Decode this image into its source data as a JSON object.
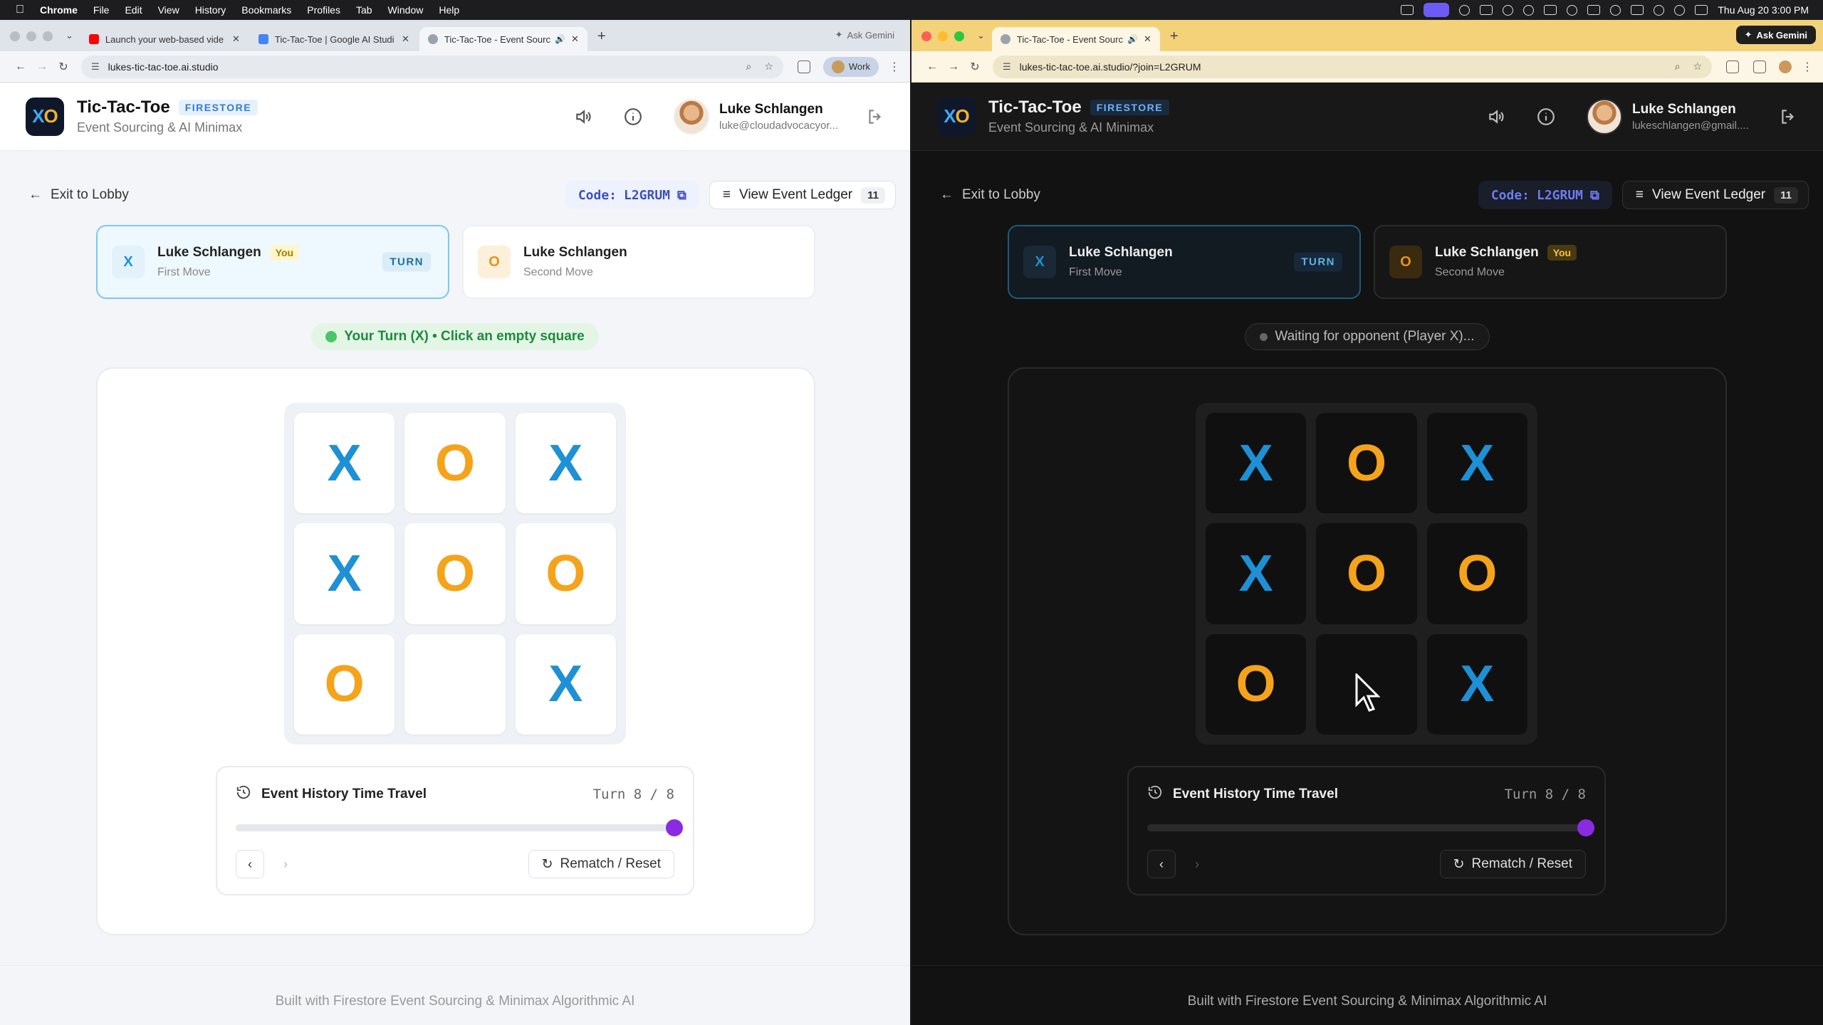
{
  "menubar": {
    "app": "Chrome",
    "items": [
      "File",
      "Edit",
      "View",
      "History",
      "Bookmarks",
      "Profiles",
      "Tab",
      "Window",
      "Help"
    ],
    "clock": "Thu Aug 20  3:00 PM"
  },
  "colors": {
    "x": "#1e90d6",
    "o": "#f5a31a",
    "accent": "#8a2be2",
    "ok": "#4bc46a"
  },
  "left": {
    "tabs": [
      {
        "title": "Launch your web-based vide",
        "icon": "youtube-icon"
      },
      {
        "title": "Tic-Tac-Toe | Google AI Studi",
        "icon": "ai-studio-icon"
      },
      {
        "title": "Tic-Tac-Toe - Event Sourc",
        "icon": "globe-icon",
        "active": true
      }
    ],
    "ask_gemini": "Ask Gemini",
    "url": "lukes-tic-tac-toe.ai.studio",
    "profile_label": "Work",
    "user": {
      "name": "Luke Schlangen",
      "email": "luke@cloudadvocacyor..."
    },
    "players": [
      {
        "symbol": "X",
        "name": "Luke Schlangen",
        "you": "You",
        "move": "First Move",
        "turn": "TURN"
      },
      {
        "symbol": "O",
        "name": "Luke Schlangen",
        "move": "Second Move"
      }
    ],
    "status": "Your Turn (X) • Click an empty square"
  },
  "right": {
    "tabs": [
      {
        "title": "Tic-Tac-Toe - Event Sourc",
        "icon": "globe-icon",
        "active": true
      }
    ],
    "ask_gemini": "Ask Gemini",
    "url": "lukes-tic-tac-toe.ai.studio/?join=L2GRUM",
    "user": {
      "name": "Luke Schlangen",
      "email": "lukeschlangen@gmail...."
    },
    "players": [
      {
        "symbol": "X",
        "name": "Luke Schlangen",
        "move": "First Move",
        "turn": "TURN"
      },
      {
        "symbol": "O",
        "name": "Luke Schlangen",
        "you": "You",
        "move": "Second Move"
      }
    ],
    "status": "Waiting for opponent (Player X)..."
  },
  "app": {
    "logo": "XO",
    "title": "Tic-Tac-Toe",
    "badge": "FIRESTORE",
    "subtitle": "Event Sourcing & AI Minimax",
    "exit": "Exit to Lobby",
    "code_label": "Code:",
    "code": "L2GRUM",
    "ledger_label": "View Event Ledger",
    "ledger_count": "11",
    "board": [
      "X",
      "O",
      "X",
      "X",
      "O",
      "O",
      "O",
      "",
      "X"
    ],
    "time_travel": {
      "title": "Event History Time Travel",
      "turn_text": "Turn 8 / 8",
      "current": 8,
      "total": 8
    },
    "rematch": "Rematch / Reset",
    "footer": "Built with Firestore Event Sourcing & Minimax Algorithmic AI"
  }
}
